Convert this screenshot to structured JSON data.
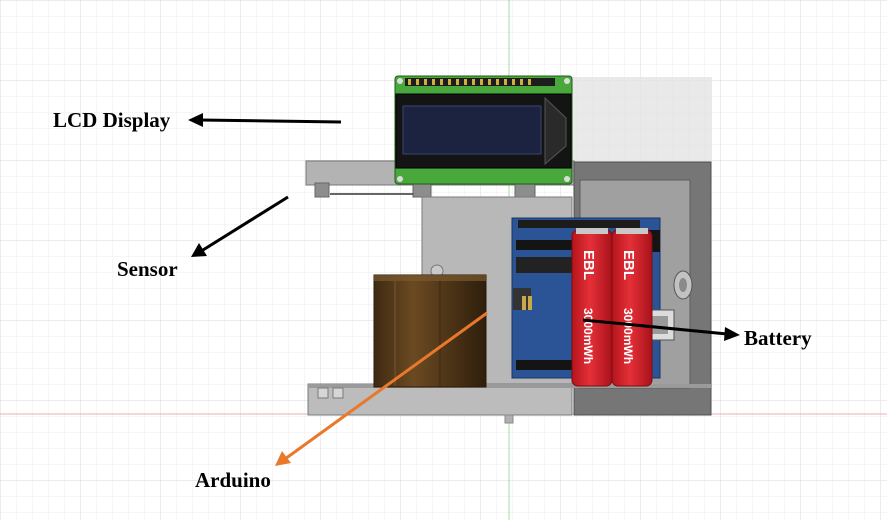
{
  "labels": {
    "lcd": "LCD Display",
    "sensor": "Sensor",
    "battery": "Battery",
    "arduino": "Arduino"
  },
  "battery_print": {
    "brand": "EBL",
    "capacity": "3000mWh"
  },
  "colors": {
    "grid_minor": "#e6e6e6",
    "grid_major": "#d6d6d6",
    "axis_vertical": "#9fd79f",
    "axis_horizontal": "#e6a0a0",
    "housing": "#a8a8a8",
    "housing_dark": "#6e6e6e",
    "lcd_pcb": "#3c9a3c",
    "lcd_screen": "#1c2238",
    "arduino_pcb": "#2a4e8c",
    "battery": "#d4212a",
    "container": "#5a3c1a",
    "arrow_black": "#000000",
    "arrow_orange": "#e8782c"
  }
}
